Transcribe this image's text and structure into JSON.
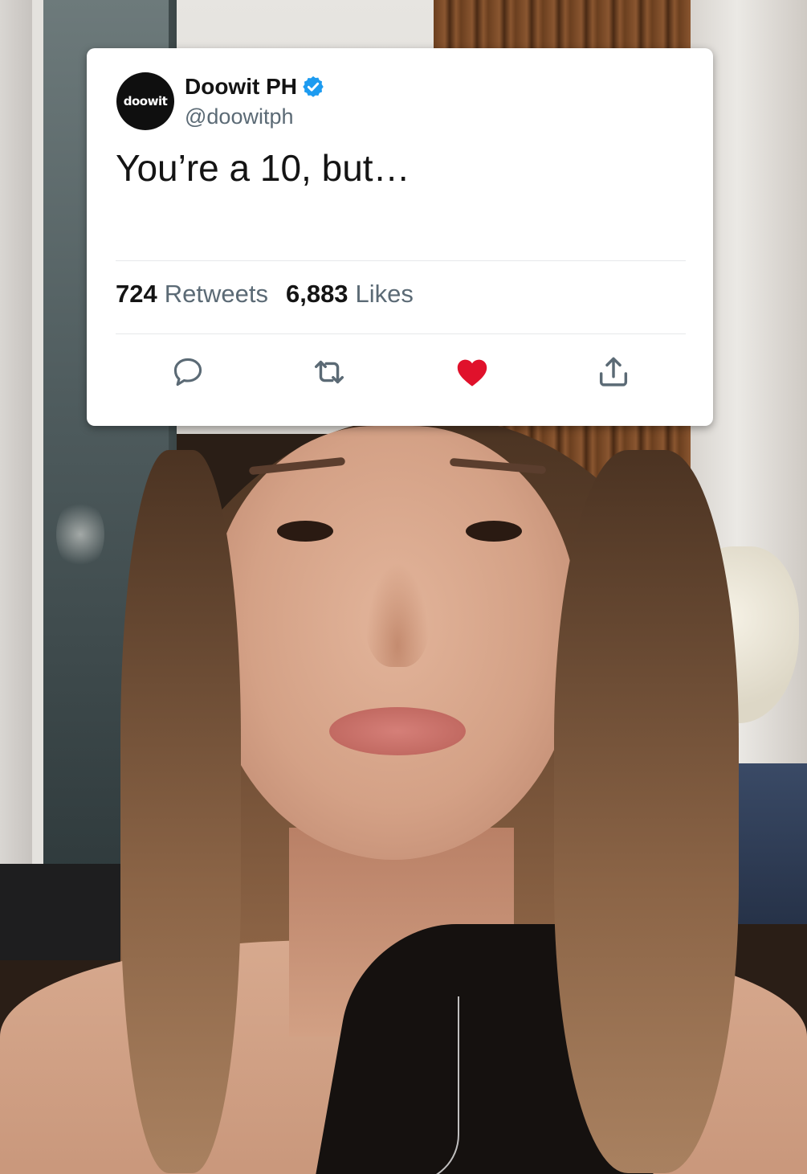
{
  "tweet": {
    "avatar_label": "doowit",
    "display_name": "Doowit PH",
    "handle": "@doowitph",
    "text": "You’re a 10, but…",
    "retweets_count": "724",
    "retweets_label": "Retweets",
    "likes_count": "6,883",
    "likes_label": "Likes",
    "verified": true,
    "liked": true,
    "actions": [
      {
        "name": "reply",
        "icon": "speech-bubble-icon"
      },
      {
        "name": "retweet",
        "icon": "retweet-arrows-icon"
      },
      {
        "name": "like",
        "icon": "heart-icon"
      },
      {
        "name": "share",
        "icon": "share-upload-icon"
      }
    ]
  },
  "colors": {
    "verified_badge": "#1d9bf0",
    "like_red": "#e0112b",
    "icon_gray": "#5b6a75",
    "card_bg": "#ffffff"
  }
}
